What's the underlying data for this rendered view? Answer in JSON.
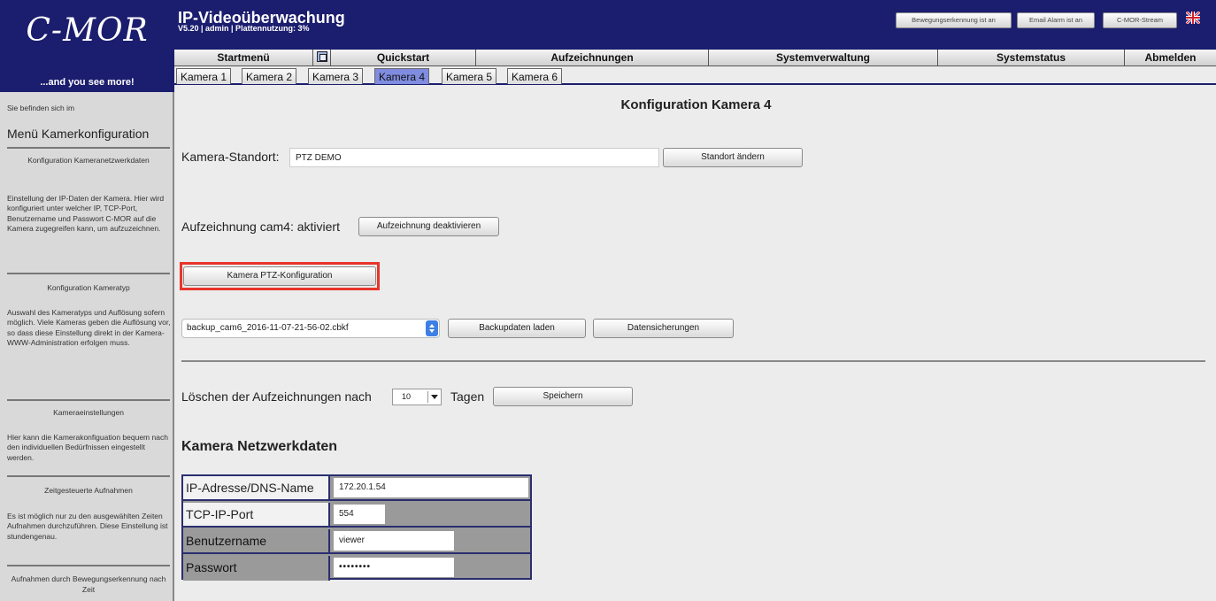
{
  "brand": {
    "logo": "C-MOR",
    "tagline": "...and you see more!"
  },
  "header": {
    "title": "IP-Videoüberwachung",
    "subtitle": "V5.20 | admin | Plattennutzung: 3%",
    "status_buttons": [
      "Bewegungserkennung ist an",
      "Email Alarm ist an",
      "C-MOR-Stream"
    ]
  },
  "main_nav": [
    "Startmenü",
    "Quickstart",
    "Aufzeichnungen",
    "Systemverwaltung",
    "Systemstatus",
    "Abmelden"
  ],
  "camera_tabs": [
    "Kamera 1",
    "Kamera 2",
    "Kamera 3",
    "Kamera 4",
    "Kamera 5",
    "Kamera 6"
  ],
  "active_tab": "Kamera 4",
  "sidebar": {
    "location_prefix": "Sie befinden sich im",
    "menu_title": "Menü Kamerkonfiguration",
    "sections": [
      {
        "title": "Konfiguration Kameranetzwerkdaten",
        "text": "Einstellung der IP-Daten der Kamera. Hier wird konfiguriert unter welcher IP, TCP-Port, Benutzername und Passwort C-MOR auf die Kamera zugegreifen kann, um aufzuzeichnen."
      },
      {
        "title": "Konfiguration Kameratyp",
        "text": "Auswahl des Kameratyps und Auflösung sofern möglich. Viele Kameras geben die Auflösung vor, so dass diese Einstellung direkt in der Kamera- WWW-Administration erfolgen muss."
      },
      {
        "title": "Kameraeinstellungen",
        "text": "Hier kann die Kamerakonfiguation bequem nach den individuellen Bedürfnissen eingestellt werden."
      },
      {
        "title": "Zeitgesteuerte Aufnahmen",
        "text": "Es ist möglich nur zu den ausgewählten Zeiten Aufnahmen durchzuführen. Diese Einstellung ist stundengenau."
      },
      {
        "title": "Aufnahmen durch Bewegungserkennung nach Zeit",
        "text": ""
      }
    ]
  },
  "main": {
    "page_title": "Konfiguration Kamera 4",
    "location_label": "Kamera-Standort:",
    "location_value": "PTZ DEMO",
    "location_button": "Standort ändern",
    "recording_status": "Aufzeichnung cam4: aktiviert",
    "recording_button": "Aufzeichnung deaktivieren",
    "ptz_button": "Kamera PTZ-Konfiguration",
    "backup_select": "backup_cam6_2016-11-07-21-56-02.cbkf",
    "backup_load_button": "Backupdaten laden",
    "backups_button": "Datensicherungen",
    "delete_label_before": "Löschen der Aufzeichnungen nach",
    "delete_days": "10",
    "delete_label_after": "Tagen",
    "save_button": "Speichern",
    "network_title": "Kamera Netzwerkdaten",
    "network_rows": [
      {
        "label": "IP-Adresse/DNS-Name",
        "value": "172.20.1.54"
      },
      {
        "label": "TCP-IP-Port",
        "value": "554"
      },
      {
        "label": "Benutzername",
        "value": "viewer"
      },
      {
        "label": "Passwort",
        "value": "••••••••"
      }
    ]
  },
  "colors": {
    "header_bg": "#1b1d6e",
    "active_tab": "#7f8ce0",
    "highlight": "#e8352a"
  }
}
